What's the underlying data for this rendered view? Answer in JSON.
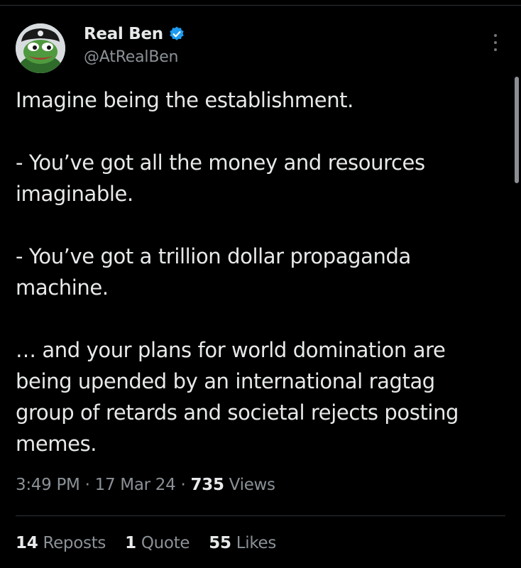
{
  "tweet": {
    "author": {
      "display_name": "Real Ben",
      "handle": "@AtRealBen",
      "verified": true,
      "verified_color": "#1d9bf0"
    },
    "more_icon": "more-vertical-icon",
    "text_lines": [
      "Imagine being the establishment.",
      "",
      "- You’ve got all the money and resources",
      "imaginable.",
      "",
      "- You’ve got a trillion dollar propaganda",
      "machine.",
      "",
      "… and your plans for world domination are",
      "being upended by an international ragtag",
      "group of retards and societal rejects posting",
      "memes."
    ],
    "meta": {
      "time": "3:49 PM",
      "separator": "·",
      "date": "17 Mar 24",
      "views_count": "735",
      "views_label": "Views"
    },
    "stats": {
      "reposts_count": "14",
      "reposts_label": "Reposts",
      "quotes_count": "1",
      "quotes_label": "Quote",
      "likes_count": "55",
      "likes_label": "Likes"
    }
  }
}
